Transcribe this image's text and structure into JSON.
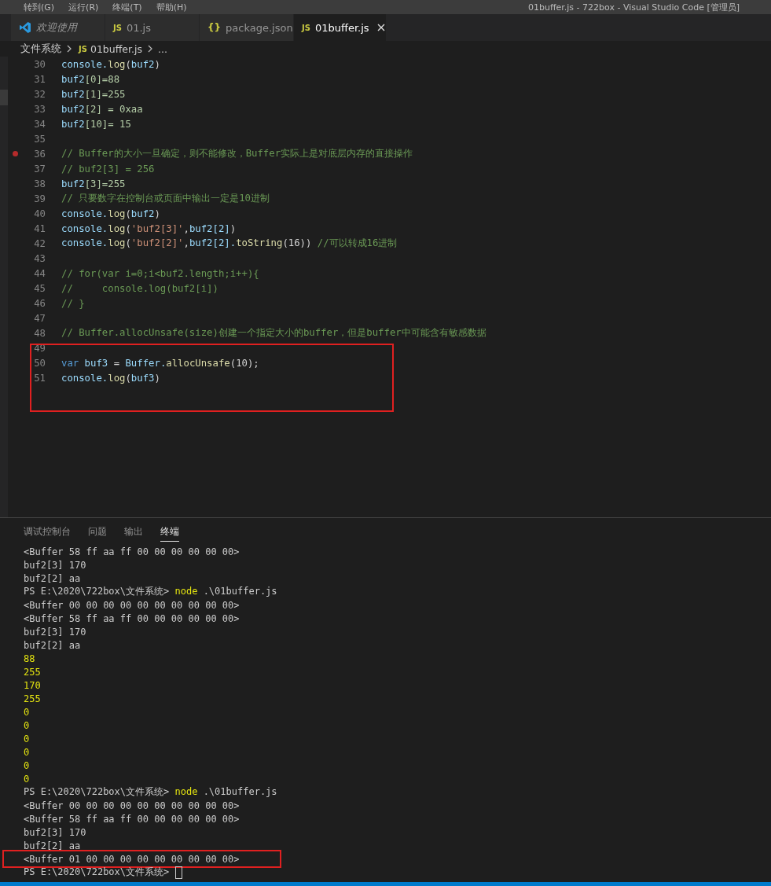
{
  "title_bar": {
    "menus": [
      "转到(G)",
      "运行(R)",
      "终端(T)",
      "帮助(H)"
    ],
    "title": "01buffer.js - 722box - Visual Studio Code [管理员]"
  },
  "tabs": [
    {
      "label": "欢迎使用",
      "kind": "welcome",
      "selected": false
    },
    {
      "label": "01.js",
      "kind": "js",
      "icon_text": "JS",
      "selected": false
    },
    {
      "label": "package.json",
      "kind": "json",
      "icon_text": "{}",
      "selected": false
    },
    {
      "label": "01buffer.js",
      "kind": "js",
      "icon_text": "JS",
      "selected": true
    }
  ],
  "breadcrumb": {
    "folder": "文件系统",
    "file_icon": "JS",
    "file": "01buffer.js",
    "more": "..."
  },
  "editor_lines": [
    {
      "number": "30",
      "breakpoint": false,
      "annotated": false,
      "tokens": [
        {
          "text": "console.",
          "kind": "var"
        },
        {
          "text": "log",
          "kind": "func"
        },
        {
          "text": "(",
          "kind": "plain"
        },
        {
          "text": "buf2",
          "kind": "var"
        },
        {
          "text": ")",
          "kind": "plain"
        }
      ]
    },
    {
      "number": "31",
      "breakpoint": false,
      "annotated": false,
      "tokens": [
        {
          "text": "buf2",
          "kind": "var"
        },
        {
          "text": "[0]=88",
          "kind": "num"
        }
      ]
    },
    {
      "number": "32",
      "breakpoint": false,
      "annotated": false,
      "tokens": [
        {
          "text": "buf2",
          "kind": "var"
        },
        {
          "text": "[1]=255",
          "kind": "num"
        }
      ]
    },
    {
      "number": "33",
      "breakpoint": false,
      "annotated": false,
      "tokens": [
        {
          "text": "buf2",
          "kind": "var"
        },
        {
          "text": "[2] = 0xaa",
          "kind": "num"
        }
      ]
    },
    {
      "number": "34",
      "breakpoint": false,
      "annotated": false,
      "tokens": [
        {
          "text": "buf2",
          "kind": "var"
        },
        {
          "text": "[10]= 15",
          "kind": "num"
        }
      ]
    },
    {
      "number": "35",
      "breakpoint": false,
      "annotated": false
    },
    {
      "number": "36",
      "breakpoint": true,
      "annotated": false,
      "tokens": [
        {
          "text": "// Buffer的大小一旦确定，则不能修改，Buffer实际上是对底层内存的直接操作",
          "kind": "comment"
        }
      ]
    },
    {
      "number": "37",
      "breakpoint": false,
      "annotated": false,
      "tokens": [
        {
          "text": "// buf2[3] = 256",
          "kind": "comment"
        }
      ]
    },
    {
      "number": "38",
      "breakpoint": false,
      "annotated": false,
      "tokens": [
        {
          "text": "buf2",
          "kind": "var"
        },
        {
          "text": "[3]=255",
          "kind": "num"
        }
      ]
    },
    {
      "number": "39",
      "breakpoint": false,
      "annotated": false,
      "tokens": [
        {
          "text": "// 只要数字在控制台或页面中输出一定是10进制",
          "kind": "comment"
        }
      ]
    },
    {
      "number": "40",
      "breakpoint": false,
      "annotated": false,
      "tokens": [
        {
          "text": "console.",
          "kind": "var"
        },
        {
          "text": "log",
          "kind": "func"
        },
        {
          "text": "(",
          "kind": "plain"
        },
        {
          "text": "buf2",
          "kind": "var"
        },
        {
          "text": ")",
          "kind": "plain"
        }
      ]
    },
    {
      "number": "41",
      "breakpoint": false,
      "annotated": false,
      "tokens": [
        {
          "text": "console.",
          "kind": "var"
        },
        {
          "text": "log",
          "kind": "func"
        },
        {
          "text": "(",
          "kind": "plain"
        },
        {
          "text": "'buf2[3]'",
          "kind": "string"
        },
        {
          "text": ",",
          "kind": "plain"
        },
        {
          "text": "buf2[2]",
          "kind": "var"
        },
        {
          "text": ")",
          "kind": "plain"
        }
      ]
    },
    {
      "number": "42",
      "breakpoint": false,
      "annotated": false,
      "tokens": [
        {
          "text": "console.",
          "kind": "var"
        },
        {
          "text": "log",
          "kind": "func"
        },
        {
          "text": "(",
          "kind": "plain"
        },
        {
          "text": "'buf2[2]'",
          "kind": "string"
        },
        {
          "text": ",",
          "kind": "plain"
        },
        {
          "text": "buf2[2].",
          "kind": "var"
        },
        {
          "text": "toString",
          "kind": "func"
        },
        {
          "text": "(16)) ",
          "kind": "plain"
        },
        {
          "text": "//可以转成16进制",
          "kind": "comment"
        }
      ]
    },
    {
      "number": "43",
      "breakpoint": false,
      "annotated": false
    },
    {
      "number": "44",
      "breakpoint": false,
      "annotated": false,
      "tokens": [
        {
          "text": "// for(var i=0;i<buf2.length;i++){",
          "kind": "comment"
        }
      ]
    },
    {
      "number": "45",
      "breakpoint": false,
      "annotated": false,
      "tokens": [
        {
          "text": "//     console.log(buf2[i])",
          "kind": "comment"
        }
      ]
    },
    {
      "number": "46",
      "breakpoint": false,
      "annotated": false,
      "tokens": [
        {
          "text": "// }",
          "kind": "comment"
        }
      ]
    },
    {
      "number": "47",
      "breakpoint": false,
      "annotated": false
    },
    {
      "number": "48",
      "breakpoint": false,
      "annotated": false,
      "tokens": [
        {
          "text": "// Buffer.allocUnsafe(size)创建一个指定大小的buffer，但是buffer中可能含有敏感数据",
          "kind": "comment"
        }
      ]
    },
    {
      "number": "49",
      "breakpoint": false,
      "annotated": true
    },
    {
      "number": "50",
      "breakpoint": false,
      "annotated": true,
      "tokens": [
        {
          "text": "var",
          "kind": "keyword"
        },
        {
          "text": " buf3",
          "kind": "var"
        },
        {
          "text": " = ",
          "kind": "plain"
        },
        {
          "text": "Buffer.",
          "kind": "var"
        },
        {
          "text": "allocUnsafe",
          "kind": "func"
        },
        {
          "text": "(10);",
          "kind": "plain"
        }
      ]
    },
    {
      "number": "51",
      "breakpoint": false,
      "annotated": true,
      "tokens": [
        {
          "text": "console.",
          "kind": "var"
        },
        {
          "text": "log",
          "kind": "func"
        },
        {
          "text": "(",
          "kind": "plain"
        },
        {
          "text": "buf3",
          "kind": "var"
        },
        {
          "text": ")",
          "kind": "plain"
        }
      ]
    }
  ],
  "panel_tabs": [
    {
      "label": "调试控制台",
      "selected": false
    },
    {
      "label": "问题",
      "selected": false
    },
    {
      "label": "输出",
      "selected": false
    },
    {
      "label": "终端",
      "selected": true
    }
  ],
  "terminal_lines": [
    {
      "annotated": false,
      "cursor": false,
      "tokens": [
        {
          "text": "<Buffer 58 ff aa ff 00 00 00 00 00 00>",
          "kind": "plain"
        }
      ]
    },
    {
      "annotated": false,
      "cursor": false,
      "tokens": [
        {
          "text": "buf2[3] 170",
          "kind": "plain"
        }
      ]
    },
    {
      "annotated": false,
      "cursor": false,
      "tokens": [
        {
          "text": "buf2[2] aa",
          "kind": "plain"
        }
      ]
    },
    {
      "annotated": false,
      "cursor": false,
      "tokens": [
        {
          "text": "PS E:\\2020\\722box\\文件系统> ",
          "kind": "plain"
        },
        {
          "text": "node",
          "kind": "command"
        },
        {
          "text": " .\\01buffer.js",
          "kind": "plain"
        }
      ]
    },
    {
      "annotated": false,
      "cursor": false,
      "tokens": [
        {
          "text": "<Buffer 00 00 00 00 00 00 00 00 00 00>",
          "kind": "plain"
        }
      ]
    },
    {
      "annotated": false,
      "cursor": false,
      "tokens": [
        {
          "text": "<Buffer 58 ff aa ff 00 00 00 00 00 00>",
          "kind": "plain"
        }
      ]
    },
    {
      "annotated": false,
      "cursor": false,
      "tokens": [
        {
          "text": "buf2[3] 170",
          "kind": "plain"
        }
      ]
    },
    {
      "annotated": false,
      "cursor": false,
      "tokens": [
        {
          "text": "buf2[2] aa",
          "kind": "plain"
        }
      ]
    },
    {
      "annotated": false,
      "cursor": false,
      "tokens": [
        {
          "text": "88",
          "kind": "number"
        }
      ]
    },
    {
      "annotated": false,
      "cursor": false,
      "tokens": [
        {
          "text": "255",
          "kind": "number"
        }
      ]
    },
    {
      "annotated": false,
      "cursor": false,
      "tokens": [
        {
          "text": "170",
          "kind": "number"
        }
      ]
    },
    {
      "annotated": false,
      "cursor": false,
      "tokens": [
        {
          "text": "255",
          "kind": "number"
        }
      ]
    },
    {
      "annotated": false,
      "cursor": false,
      "tokens": [
        {
          "text": "0",
          "kind": "number"
        }
      ]
    },
    {
      "annotated": false,
      "cursor": false,
      "tokens": [
        {
          "text": "0",
          "kind": "number"
        }
      ]
    },
    {
      "annotated": false,
      "cursor": false,
      "tokens": [
        {
          "text": "0",
          "kind": "number"
        }
      ]
    },
    {
      "annotated": false,
      "cursor": false,
      "tokens": [
        {
          "text": "0",
          "kind": "number"
        }
      ]
    },
    {
      "annotated": false,
      "cursor": false,
      "tokens": [
        {
          "text": "0",
          "kind": "number"
        }
      ]
    },
    {
      "annotated": false,
      "cursor": false,
      "tokens": [
        {
          "text": "0",
          "kind": "number"
        }
      ]
    },
    {
      "annotated": false,
      "cursor": false,
      "tokens": [
        {
          "text": "PS E:\\2020\\722box\\文件系统> ",
          "kind": "plain"
        },
        {
          "text": "node",
          "kind": "command"
        },
        {
          "text": " .\\01buffer.js",
          "kind": "plain"
        }
      ]
    },
    {
      "annotated": false,
      "cursor": false,
      "tokens": [
        {
          "text": "<Buffer 00 00 00 00 00 00 00 00 00 00>",
          "kind": "plain"
        }
      ]
    },
    {
      "annotated": false,
      "cursor": false,
      "tokens": [
        {
          "text": "<Buffer 58 ff aa ff 00 00 00 00 00 00>",
          "kind": "plain"
        }
      ]
    },
    {
      "annotated": false,
      "cursor": false,
      "tokens": [
        {
          "text": "buf2[3] 170",
          "kind": "plain"
        }
      ]
    },
    {
      "annotated": false,
      "cursor": false,
      "tokens": [
        {
          "text": "buf2[2] aa",
          "kind": "plain"
        }
      ]
    },
    {
      "annotated": true,
      "cursor": false,
      "tokens": [
        {
          "text": "<Buffer 01 00 00 00 00 00 00 00 00 00>",
          "kind": "plain"
        }
      ]
    },
    {
      "annotated": false,
      "cursor": true,
      "tokens": [
        {
          "text": "PS E:\\2020\\722box\\文件系统> ",
          "kind": "plain"
        }
      ]
    }
  ]
}
